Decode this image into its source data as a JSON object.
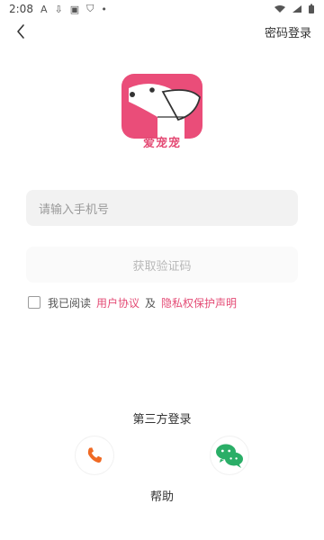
{
  "status_bar": {
    "time": "2:08",
    "icons": [
      "accessibility-icon",
      "download-icon",
      "image-icon",
      "shield-icon",
      "dot-icon",
      "wifi-icon",
      "signal-icon",
      "battery-icon"
    ]
  },
  "nav": {
    "back_icon": "chevron-left-icon",
    "right_action": "密码登录"
  },
  "logo": {
    "brand_text": "爱宠宠",
    "accent_color": "#ea4d79"
  },
  "form": {
    "phone_placeholder": "请输入手机号",
    "get_code_label": "获取验证码",
    "agreement_prefix": "我已阅读",
    "agreement_user": "用户协议",
    "agreement_mid": "及",
    "agreement_privacy": "隐私权保护声明"
  },
  "third_party": {
    "title": "第三方登录",
    "methods": [
      {
        "name": "phone",
        "icon": "phone-icon",
        "color": "#f06a24"
      },
      {
        "name": "wechat",
        "icon": "wechat-icon",
        "color": "#2aae67"
      }
    ]
  },
  "footer": {
    "help_label": "帮助"
  }
}
